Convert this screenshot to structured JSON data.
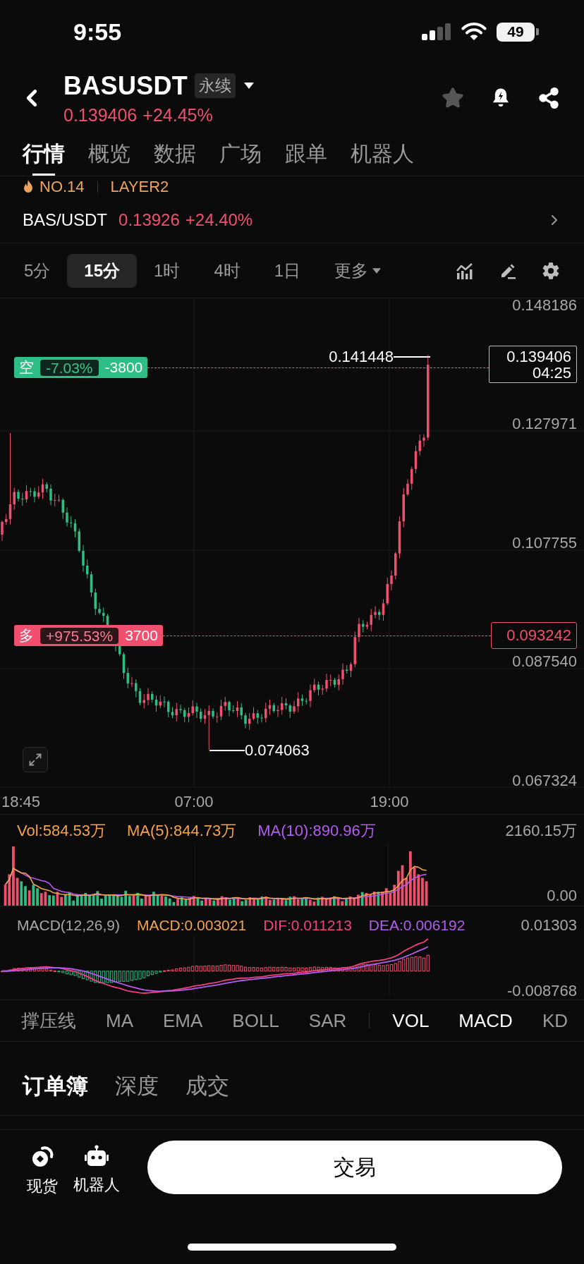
{
  "status_bar": {
    "time": "9:55",
    "battery": "49"
  },
  "header": {
    "symbol": "BASUSDT",
    "contract_badge": "永续",
    "price": "0.139406",
    "change": "+24.45%"
  },
  "tabs": [
    {
      "label": "行情",
      "selected": true
    },
    {
      "label": "概览",
      "selected": false
    },
    {
      "label": "数据",
      "selected": false
    },
    {
      "label": "广场",
      "selected": false
    },
    {
      "label": "跟单",
      "selected": false
    },
    {
      "label": "机器人",
      "selected": false
    }
  ],
  "tags": {
    "rank": "NO.14",
    "sector": "LAYER2"
  },
  "spot_pair": {
    "pair": "BAS/USDT",
    "price": "0.13926",
    "change": "+24.40%"
  },
  "intervals": [
    {
      "label": "5分",
      "selected": false,
      "kind": "option"
    },
    {
      "label": "15分",
      "selected": true,
      "kind": "option"
    },
    {
      "label": "1时",
      "selected": false,
      "kind": "option"
    },
    {
      "label": "4时",
      "selected": false,
      "kind": "option"
    },
    {
      "label": "1日",
      "selected": false,
      "kind": "option"
    },
    {
      "label": "更多",
      "selected": false,
      "kind": "menu"
    }
  ],
  "chart": {
    "price_axis": [
      "0.148186",
      "0.127971",
      "0.107755",
      "0.087540",
      "0.067324"
    ],
    "time_axis": [
      "18:45",
      "07:00",
      "19:00"
    ],
    "high": "0.141448",
    "low": "0.074063",
    "last_price": "0.139406",
    "countdown": "04:25",
    "positions": [
      {
        "kind": "short",
        "side": "空",
        "pnl": "-7.03%",
        "size": "-3800"
      },
      {
        "kind": "long",
        "side": "多",
        "pnl": "+975.53%",
        "size": "3700",
        "price": "0.093242"
      }
    ]
  },
  "volume": {
    "legend": [
      {
        "label": "Vol:584.53万",
        "color": "#f4a24c"
      },
      {
        "label": "MA(5):844.73万",
        "color": "#f4a24c"
      },
      {
        "label": "MA(10):890.96万",
        "color": "#b35cf0"
      }
    ],
    "axis": [
      "2160.15万",
      "0.00"
    ]
  },
  "macd": {
    "title": "MACD(12,26,9)",
    "legend": [
      {
        "label": "MACD:0.003021",
        "color": "#f4a24c"
      },
      {
        "label": "DIF:0.011213",
        "color": "#f0407c"
      },
      {
        "label": "DEA:0.006192",
        "color": "#b35cf0"
      }
    ],
    "axis": [
      "0.01303",
      "-0.008768"
    ]
  },
  "indicators": {
    "main": [
      {
        "label": "撑压线",
        "selected": false
      },
      {
        "label": "MA",
        "selected": false
      },
      {
        "label": "EMA",
        "selected": false
      },
      {
        "label": "BOLL",
        "selected": false
      },
      {
        "label": "SAR",
        "selected": false
      }
    ],
    "sub": [
      {
        "label": "VOL",
        "selected": true
      },
      {
        "label": "MACD",
        "selected": true
      },
      {
        "label": "KD",
        "selected": false
      }
    ]
  },
  "book_tabs": [
    {
      "label": "订单簿",
      "selected": true
    },
    {
      "label": "深度",
      "selected": false
    },
    {
      "label": "成交",
      "selected": false
    }
  ],
  "bottom_bar": {
    "items": [
      {
        "label": "现货",
        "kind": "spot"
      },
      {
        "label": "机器人",
        "kind": "bot"
      }
    ],
    "trade_button": "交易"
  }
}
